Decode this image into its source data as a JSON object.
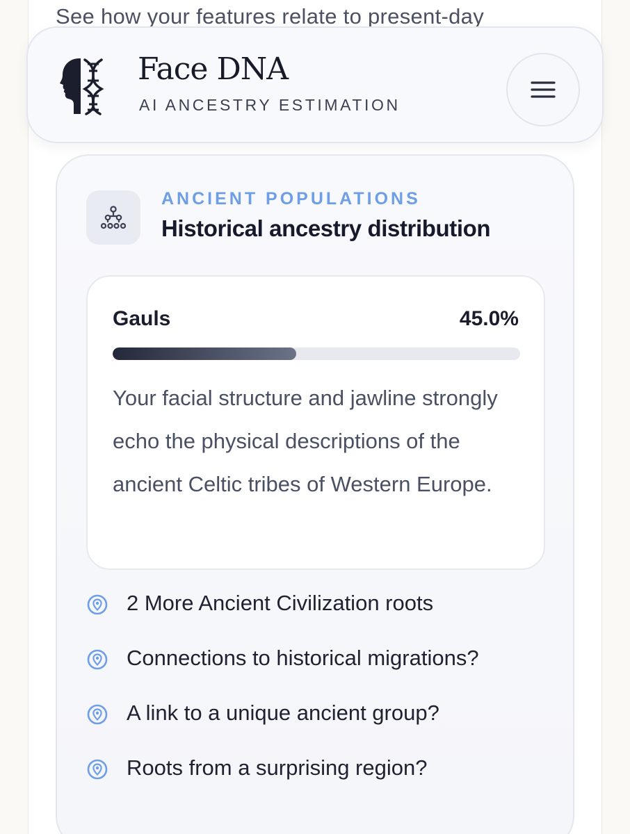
{
  "background_peek": {
    "text": "See how your features relate to present-day"
  },
  "header": {
    "brand_name": "Face DNA",
    "tagline": "AI ANCESTRY ESTIMATION",
    "logo_icon": "face-dna-logo-icon",
    "menu_icon": "hamburger-menu-icon"
  },
  "section": {
    "icon": "hierarchy-tree-icon",
    "eyebrow": "ANCIENT POPULATIONS",
    "title": "Historical ancestry distribution"
  },
  "top_result": {
    "population": "Gauls",
    "percentage_label": "45.0%",
    "percentage_value": 45.0,
    "description": "Your facial structure and jawline strongly echo the physical descriptions of the ancient Celtic tribes of Western Europe."
  },
  "teasers": {
    "icon": "location-pin-icon",
    "items": [
      {
        "text": "2 More Ancient Civilization roots"
      },
      {
        "text": "Connections to historical migrations?"
      },
      {
        "text": "A link to a unique ancient group?"
      },
      {
        "text": "Roots from a surprising region?"
      }
    ]
  },
  "colors": {
    "accent": "#6e9ee6",
    "progress_dark": "#23283a",
    "progress_light": "#6d7387",
    "track": "#e7e9ee"
  }
}
